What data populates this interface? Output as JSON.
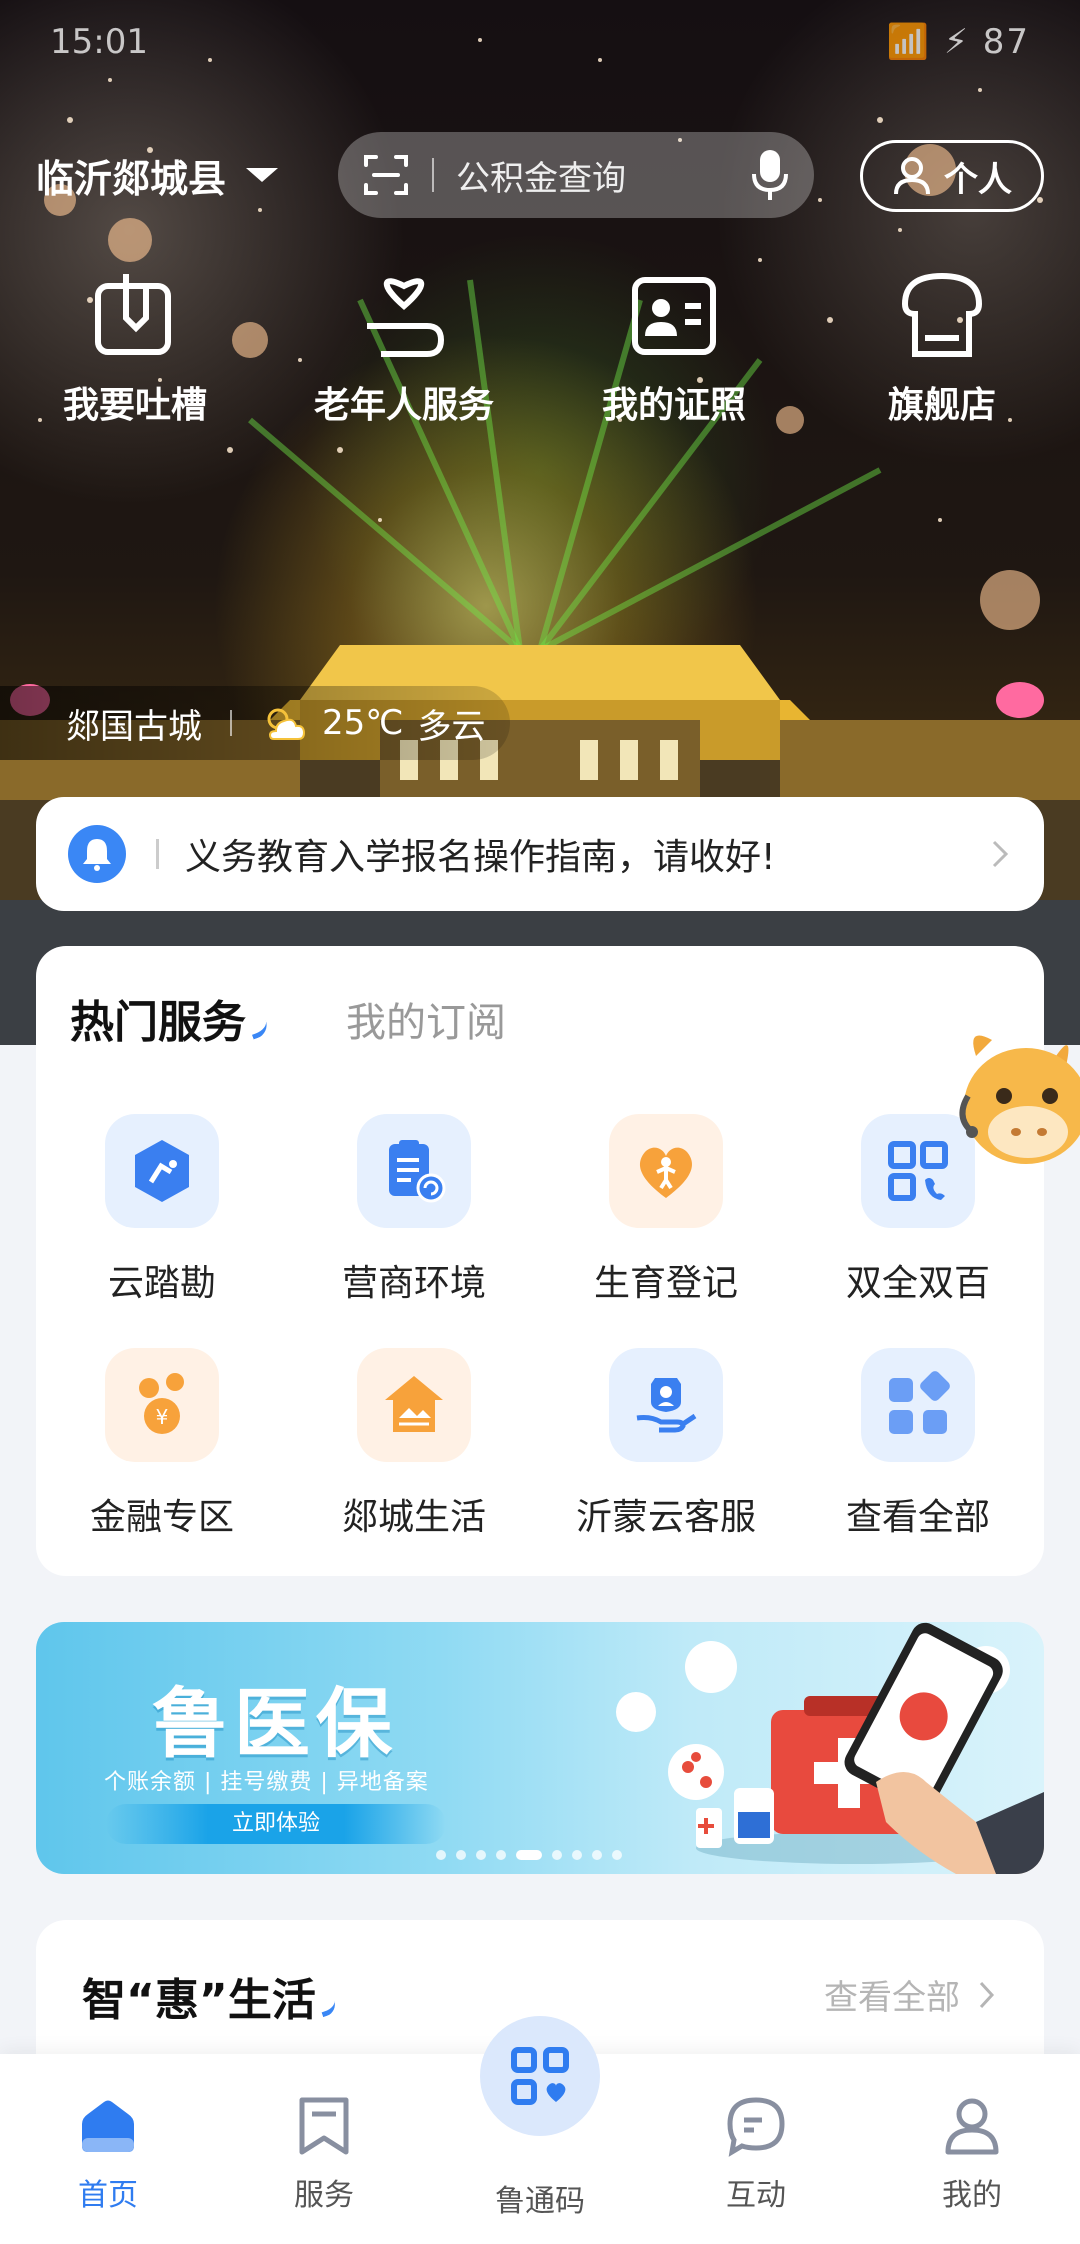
{
  "status_bar": {
    "time": "15:01",
    "right": "📶 ⚡ 87"
  },
  "header": {
    "location": "临沂郯城县",
    "search_placeholder": "公积金查询",
    "personal_label": "个人"
  },
  "quick_entries": [
    {
      "label": "我要吐槽",
      "icon": "complaint-icon"
    },
    {
      "label": "老年人服务",
      "icon": "elderly-care-icon"
    },
    {
      "label": "我的证照",
      "icon": "id-card-icon"
    },
    {
      "label": "旗舰店",
      "icon": "store-icon"
    }
  ],
  "weather": {
    "place": "郯国古城",
    "temp": "25℃",
    "condition": "多云"
  },
  "notice": {
    "text": "义务教育入学报名操作指南，请收好!"
  },
  "hot_services": {
    "tab_active": "热门服务",
    "tab_inactive": "我的订阅",
    "items": [
      {
        "label": "云踏勘",
        "icon": "robot-hex-icon",
        "bg": "#e6f0fe"
      },
      {
        "label": "营商环境",
        "icon": "document-refresh-icon",
        "bg": "#e6f0fe"
      },
      {
        "label": "生育登记",
        "icon": "baby-heart-icon",
        "bg": "#fff1e5"
      },
      {
        "label": "双全双百",
        "icon": "qr-grid-icon",
        "bg": "#e6f0fe"
      },
      {
        "label": "金融专区",
        "icon": "coins-icon",
        "bg": "#fff1e5"
      },
      {
        "label": "郯城生活",
        "icon": "house-icon",
        "bg": "#fff1e5"
      },
      {
        "label": "沂蒙云客服",
        "icon": "service-hand-icon",
        "bg": "#e6f0fe"
      },
      {
        "label": "查看全部",
        "icon": "all-apps-icon",
        "bg": "#e6f0fe"
      }
    ]
  },
  "banner": {
    "title": "鲁医保",
    "subtitle": "个账余额 | 挂号缴费 | 异地备案",
    "cta": "立即体验"
  },
  "smart_life": {
    "title": "智“惠”生活",
    "more": "查看全部"
  },
  "bottom_nav": {
    "home": "首页",
    "service": "服务",
    "code": "鲁通码",
    "interact": "互动",
    "mine": "我的"
  },
  "colors": {
    "accent": "#2f7cf0",
    "orange": "#f7a23b",
    "bg": "#f2f4f8"
  }
}
